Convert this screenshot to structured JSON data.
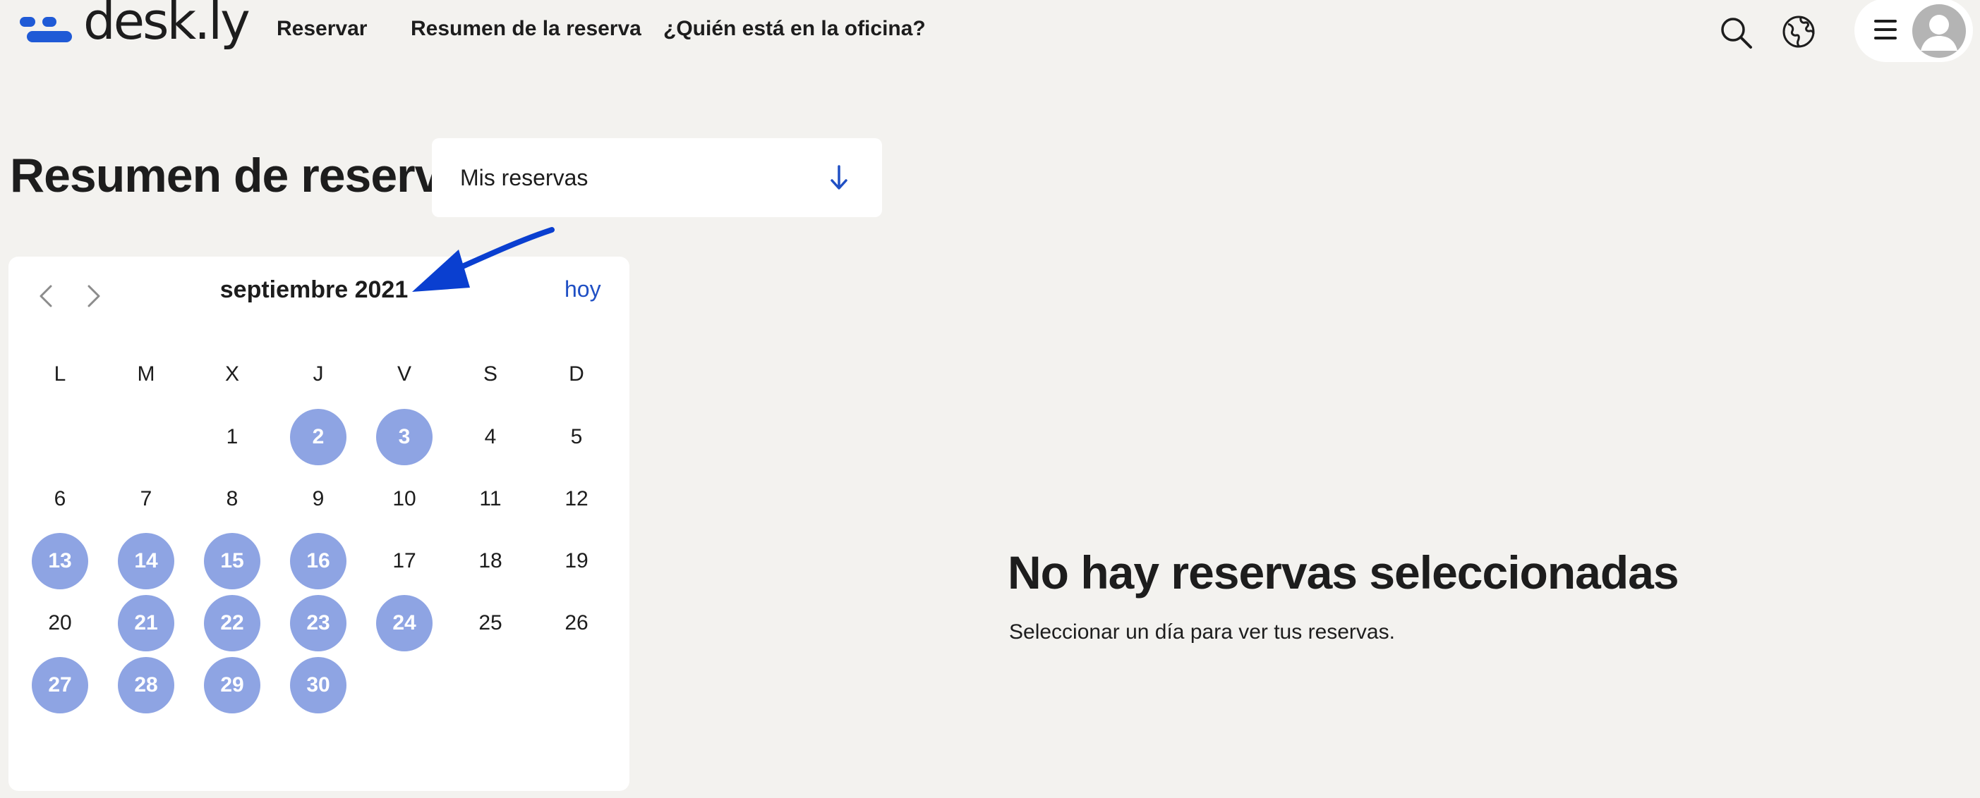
{
  "app": {
    "logo_text": "desk.ly",
    "brand_color": "#1f5ad6"
  },
  "nav": {
    "items": [
      {
        "label": "Reservar"
      },
      {
        "label": "Resumen de la reserva"
      },
      {
        "label": "¿Quién está en la oficina?"
      }
    ]
  },
  "header_icons": {
    "search": "search-icon",
    "language": "globe-icon",
    "menu": "hamburger-icon",
    "profile": "avatar"
  },
  "page": {
    "title": "Resumen de reserva",
    "view_select": {
      "value": "Mis reservas",
      "icon": "arrow-down-icon"
    }
  },
  "calendar": {
    "month_label": "septiembre 2021",
    "today_label": "hoy",
    "weekdays": [
      "L",
      "M",
      "X",
      "J",
      "V",
      "S",
      "D"
    ],
    "booked_color": "#8ea4e3",
    "weeks": [
      [
        null,
        null,
        1,
        2,
        3,
        4,
        5
      ],
      [
        6,
        7,
        8,
        9,
        10,
        11,
        12
      ],
      [
        13,
        14,
        15,
        16,
        17,
        18,
        19
      ],
      [
        20,
        21,
        22,
        23,
        24,
        25,
        26
      ],
      [
        27,
        28,
        29,
        30,
        null,
        null,
        null
      ]
    ],
    "booked_days": [
      2,
      3,
      13,
      14,
      15,
      16,
      21,
      22,
      23,
      24,
      27,
      28,
      29,
      30
    ]
  },
  "annotation": {
    "color": "#0a3fd0"
  },
  "empty_state": {
    "title": "No hay reservas seleccionadas",
    "text": "Seleccionar un día para ver tus reservas."
  }
}
